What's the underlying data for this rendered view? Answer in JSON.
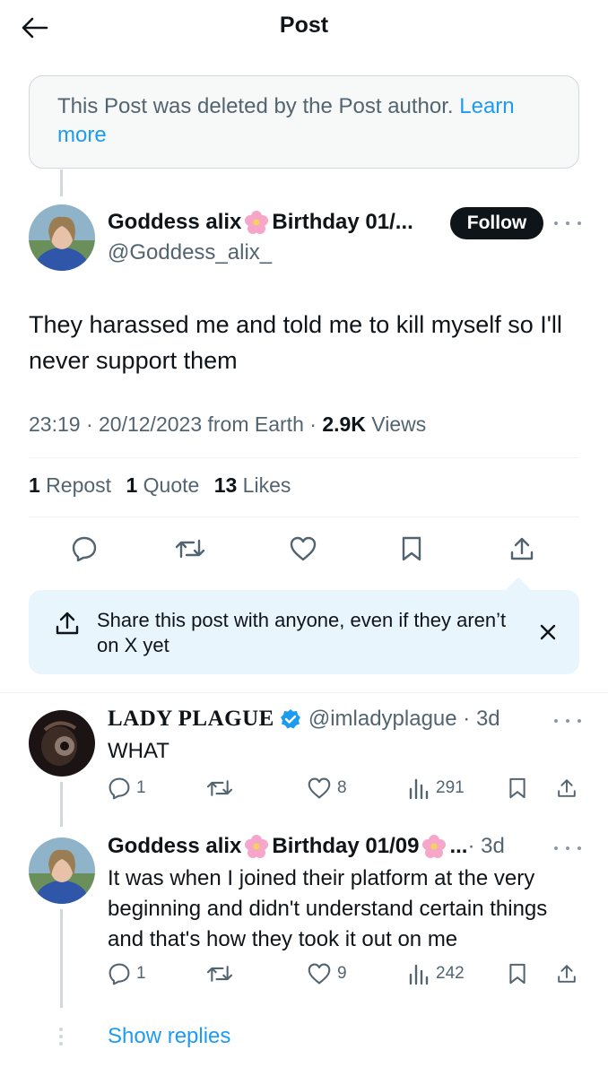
{
  "header": {
    "title": "Post",
    "back_icon": "arrow-left-icon"
  },
  "deleted_notice": {
    "text": "This Post was deleted by the Post author.",
    "link": "Learn more"
  },
  "main_post": {
    "author_name": "Goddess alix",
    "author_suffix": "Birthday 01/...",
    "handle": "@Goddess_alix_",
    "follow_label": "Follow",
    "text": "They harassed me and told me to kill myself so I'll never support them",
    "time_date": "23:19 · 20/12/2023 from Earth · ",
    "views_count": "2.9K",
    "views_label": " Views",
    "reposts_count": "1",
    "reposts_label": " Repost",
    "quotes_count": "1",
    "quotes_label": " Quote",
    "likes_count": "13",
    "likes_label": " Likes"
  },
  "share_prompt": {
    "text": "Share this post with anyone, even if they aren’t on X yet"
  },
  "replies": [
    {
      "author_name": "LADY PLAGUE",
      "verified": true,
      "handle_time": "@imladyplague · 3d",
      "text": "WHAT",
      "reply_count": "1",
      "like_count": "8",
      "view_count": "291"
    },
    {
      "author_name": "Goddess alix",
      "author_suffix": "Birthday 01/09",
      "ellipsis": "...",
      "time": " · 3d",
      "text": "It was when I joined their platform at the very beginning and didn't understand certain things and that's how they took it out on me",
      "reply_count": "1",
      "like_count": "9",
      "view_count": "242"
    }
  ],
  "show_replies": "Show replies",
  "colors": {
    "accent": "#1d9bf0",
    "text": "#0f1419",
    "muted": "#536471",
    "border": "#cfd9de"
  }
}
